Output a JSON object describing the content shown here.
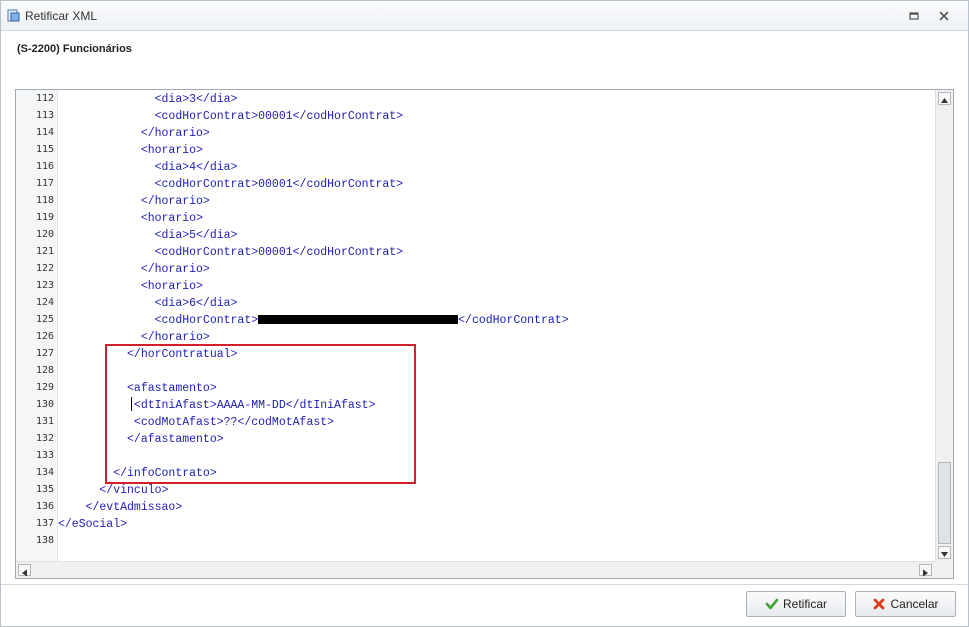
{
  "window": {
    "title": "Retificar XML",
    "section_title": "(S-2200) Funcionários"
  },
  "editor": {
    "lines": [
      {
        "no": "112",
        "text": "              <dia>3</dia>"
      },
      {
        "no": "113",
        "text": "              <codHorContrat>00001</codHorContrat>"
      },
      {
        "no": "114",
        "text": "            </horario>"
      },
      {
        "no": "115",
        "text": "            <horario>"
      },
      {
        "no": "116",
        "text": "              <dia>4</dia>"
      },
      {
        "no": "117",
        "text": "              <codHorContrat>00001</codHorContrat>"
      },
      {
        "no": "118",
        "text": "            </horario>"
      },
      {
        "no": "119",
        "text": "            <horario>"
      },
      {
        "no": "120",
        "text": "              <dia>5</dia>"
      },
      {
        "no": "121",
        "text": "              <codHorContrat>00001</codHorContrat>"
      },
      {
        "no": "122",
        "text": "            </horario>"
      },
      {
        "no": "123",
        "text": "            <horario>"
      },
      {
        "no": "124",
        "text": "              <dia>6</dia>"
      },
      {
        "no": "125",
        "text": "              <codHorContrat>",
        "redacted": true,
        "after": "</codHorContrat>"
      },
      {
        "no": "126",
        "text": "            </horario>"
      },
      {
        "no": "127",
        "text": "          </horContratual>"
      },
      {
        "no": "128",
        "text": ""
      },
      {
        "no": "129",
        "text": "          <afastamento>"
      },
      {
        "no": "130",
        "text": "           <dtIniAfast>AAAA-MM-DD</dtIniAfast>"
      },
      {
        "no": "131",
        "text": "           <codMotAfast>??</codMotAfast>"
      },
      {
        "no": "132",
        "text": "          </afastamento>"
      },
      {
        "no": "133",
        "text": ""
      },
      {
        "no": "134",
        "text": "        </infoContrato>"
      },
      {
        "no": "135",
        "text": "      </vinculo>"
      },
      {
        "no": "136",
        "text": "    </evtAdmissao>"
      },
      {
        "no": "137",
        "text": "</eSocial>"
      },
      {
        "no": "138",
        "text": ""
      }
    ]
  },
  "buttons": {
    "confirm": "Retificar",
    "cancel": "Cancelar"
  },
  "colors": {
    "tag": "#1d1db8",
    "highlight": "#d0202a",
    "confirm_icon": "#3fa535",
    "cancel_icon": "#d9411e"
  },
  "icons": {
    "app": "xml-document-icon",
    "restore": "restore-window-icon",
    "close": "close-icon",
    "confirm": "checkmark-icon",
    "cancel": "x-cross-icon"
  }
}
